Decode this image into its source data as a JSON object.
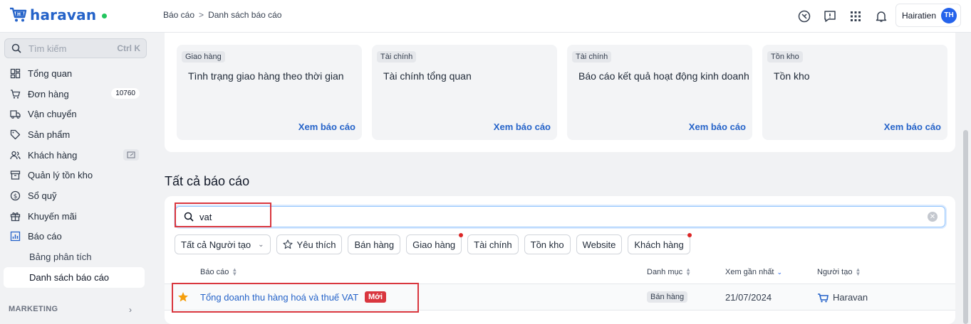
{
  "app": {
    "logo_text": "haravan"
  },
  "breadcrumb": {
    "parent": "Báo cáo",
    "separator": ">",
    "current": "Danh sách báo cáo"
  },
  "header": {
    "icons": [
      "help-icon",
      "feedback-icon",
      "apps-grid-icon",
      "bell-icon"
    ],
    "user_name": "Hairatien",
    "user_initials": "TH"
  },
  "sidebar": {
    "search_placeholder": "Tìm kiếm",
    "search_shortcut": "Ctrl K",
    "items": [
      {
        "label": "Tổng quan",
        "icon": "dashboard-icon"
      },
      {
        "label": "Đơn hàng",
        "icon": "cart-icon",
        "badge": "10760"
      },
      {
        "label": "Vận chuyển",
        "icon": "truck-icon"
      },
      {
        "label": "Sản phẩm",
        "icon": "tag-icon"
      },
      {
        "label": "Khách hàng",
        "icon": "users-icon"
      },
      {
        "label": "Quản lý tồn kho",
        "icon": "inventory-icon"
      },
      {
        "label": "Sổ quỹ",
        "icon": "dollar-icon"
      },
      {
        "label": "Khuyến mãi",
        "icon": "gift-icon"
      },
      {
        "label": "Báo cáo",
        "icon": "chart-icon"
      }
    ],
    "sub_items": [
      {
        "label": "Bảng phân tích"
      },
      {
        "label": "Danh sách báo cáo"
      }
    ],
    "section_label": "MARKETING"
  },
  "cards": [
    {
      "tag": "Giao hàng",
      "title": "Tình trạng giao hàng theo thời gian",
      "link": "Xem báo cáo"
    },
    {
      "tag": "Tài chính",
      "title": "Tài chính tổng quan",
      "link": "Xem báo cáo"
    },
    {
      "tag": "Tài chính",
      "title": "Báo cáo kết quả hoạt động kinh doanh",
      "link": "Xem báo cáo"
    },
    {
      "tag": "Tồn kho",
      "title": "Tồn kho",
      "link": "Xem báo cáo"
    }
  ],
  "all_reports": {
    "title": "Tất cả báo cáo",
    "search_value": "vat",
    "filters": [
      {
        "label": "Tất cả Người tạo"
      },
      {
        "label": "Yêu thích"
      },
      {
        "label": "Bán hàng"
      },
      {
        "label": "Giao hàng"
      },
      {
        "label": "Tài chính"
      },
      {
        "label": "Tồn kho"
      },
      {
        "label": "Website"
      },
      {
        "label": "Khách hàng"
      }
    ],
    "columns": {
      "report": "Báo cáo",
      "category": "Danh mục",
      "viewed": "Xem gần nhất",
      "creator": "Người tạo"
    },
    "rows": [
      {
        "title": "Tổng doanh thu hàng hoá và thuế VAT",
        "badge": "Mới",
        "category": "Bán hàng",
        "viewed": "21/07/2024",
        "creator": "Haravan",
        "favorite": true
      }
    ]
  },
  "colors": {
    "accent": "#2563c9",
    "highlight": "#d9363e",
    "new_badge": "#d9363e",
    "star": "#f59e0b"
  }
}
